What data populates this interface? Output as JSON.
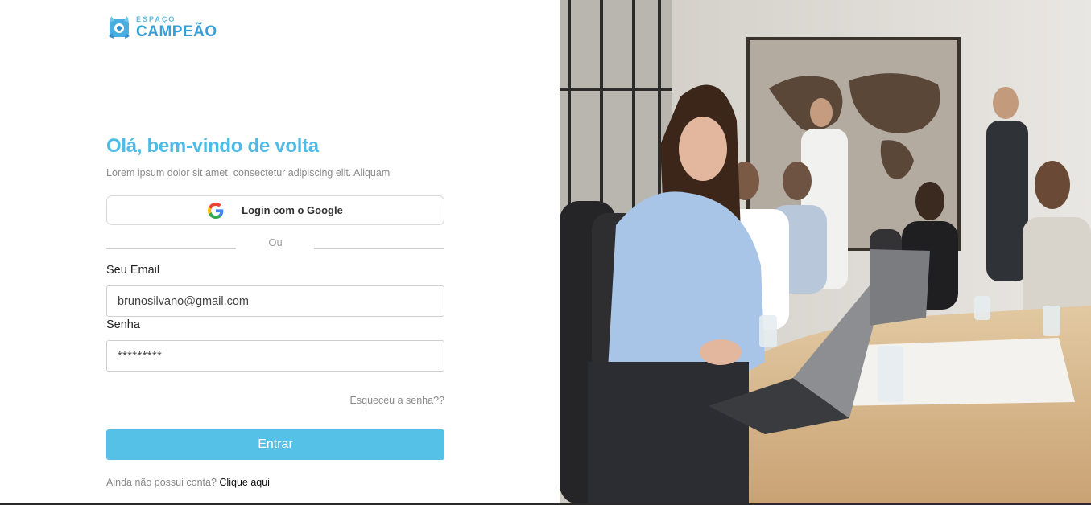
{
  "brand": {
    "small": "ESPAÇO",
    "big": "CAMPEÃO",
    "color": "#3a9fd6"
  },
  "header": {
    "title": "Olá, bem-vindo de volta",
    "subtitle": "Lorem ipsum dolor sit amet, consectetur adipiscing elit. Aliquam"
  },
  "google": {
    "label": "Login com o Google",
    "icon": "google-icon"
  },
  "divider": {
    "text": "Ou"
  },
  "form": {
    "email_label": "Seu Email",
    "email_value": "brunosilvano@gmail.com",
    "password_label": "Senha",
    "password_value": "*********",
    "forgot": "Esqueceu a senha??",
    "submit": "Entrar"
  },
  "signup": {
    "text": "Ainda não possui conta?",
    "link": "Clique aqui"
  },
  "colors": {
    "accent": "#55c1e7",
    "title": "#4ebbe6"
  }
}
